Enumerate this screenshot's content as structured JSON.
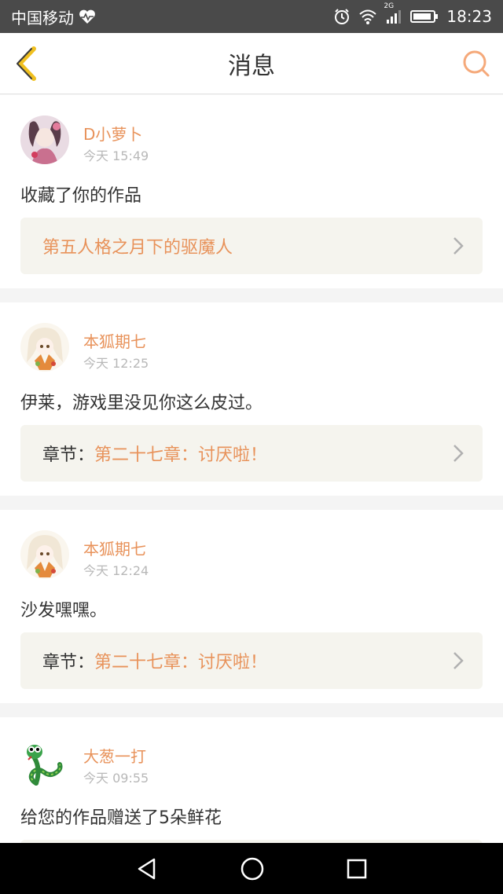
{
  "status_bar": {
    "carrier": "中国移动",
    "network": "2G",
    "time": "18:23"
  },
  "header": {
    "title": "消息"
  },
  "messages": [
    {
      "user": "D小萝卜",
      "time": "今天 15:49",
      "text": "收藏了你的作品",
      "ref_prefix": "",
      "ref_title": "第五人格之月下的驱魔人"
    },
    {
      "user": "本狐期七",
      "time": "今天 12:25",
      "text": "伊莱，游戏里没见你这么皮过。",
      "ref_prefix": "章节：",
      "ref_title": "第二十七章：讨厌啦！"
    },
    {
      "user": "本狐期七",
      "time": "今天 12:24",
      "text": "沙发嘿嘿。",
      "ref_prefix": "章节：",
      "ref_title": "第二十七章：讨厌啦！"
    },
    {
      "user": "大葱一打",
      "time": "今天 09:55",
      "text": "给您的作品赠送了5朵鲜花"
    }
  ],
  "colors": {
    "accent": "#e8925a",
    "back_icon": "#f0c020",
    "search_icon": "#f5a97a"
  }
}
